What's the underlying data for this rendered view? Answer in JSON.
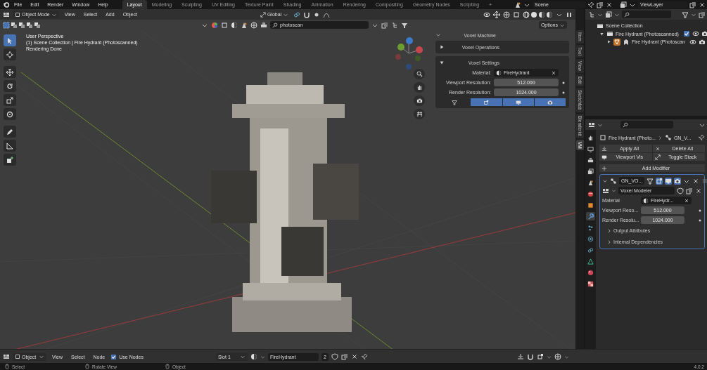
{
  "top_bar": {
    "menus": [
      "File",
      "Edit",
      "Render",
      "Window",
      "Help"
    ],
    "workspaces": [
      {
        "label": "Layout",
        "selected": true
      },
      {
        "label": "Modeling",
        "selected": false
      },
      {
        "label": "Sculpting",
        "selected": false
      },
      {
        "label": "UV Editing",
        "selected": false
      },
      {
        "label": "Texture Paint",
        "selected": false
      },
      {
        "label": "Shading",
        "selected": false
      },
      {
        "label": "Animation",
        "selected": false
      },
      {
        "label": "Rendering",
        "selected": false
      },
      {
        "label": "Compositing",
        "selected": false
      },
      {
        "label": "Geometry Nodes",
        "selected": false
      },
      {
        "label": "Scripting",
        "selected": false
      }
    ],
    "add_workspace": "+",
    "scene": "Scene",
    "view_layer": "ViewLayer"
  },
  "viewport": {
    "mode": "Object Mode",
    "menus": [
      "View",
      "Select",
      "Add",
      "Object"
    ],
    "orientation": "Global",
    "search": "photoscan",
    "options": "Options",
    "overlay_lines": [
      "User Perspective",
      "(1) Scene Collection | Fire Hydrant (Photoscanned)",
      "Rendering Done"
    ],
    "tools": [
      {
        "kind": "select",
        "selected": true
      },
      {
        "kind": "cursor",
        "selected": false
      },
      {
        "kind": "move",
        "selected": false
      },
      {
        "kind": "rotate",
        "selected": false
      },
      {
        "kind": "scale",
        "selected": false
      },
      {
        "kind": "transform",
        "selected": false
      },
      {
        "kind": "annotate",
        "selected": false
      },
      {
        "kind": "measure",
        "selected": false
      },
      {
        "kind": "add_cube",
        "selected": false
      }
    ]
  },
  "sidebar_tabs": [
    {
      "label": "Item",
      "selected": false
    },
    {
      "label": "Tool",
      "selected": false
    },
    {
      "label": "View",
      "selected": false
    },
    {
      "label": "Edit",
      "selected": false
    },
    {
      "label": "Sketchfab",
      "selected": false
    },
    {
      "label": "Blenderkit",
      "selected": false
    },
    {
      "label": "VM",
      "selected": true
    }
  ],
  "voxel_panel": {
    "title": "Voxel Machine",
    "sections": [
      {
        "title": "Voxel Operations",
        "expanded": false
      },
      {
        "title": "Voxel Settings",
        "expanded": true
      }
    ],
    "material_label": "Material:",
    "material": "FireHydrant",
    "fields": [
      {
        "label": "Viewport Resolution:",
        "value": "512.000"
      },
      {
        "label": "Render Resolution:",
        "value": "1024.000"
      }
    ],
    "toggles": [
      {
        "kind": "funnel",
        "on": false
      },
      {
        "kind": "edit",
        "on": true
      },
      {
        "kind": "monitor",
        "on": true
      },
      {
        "kind": "camera",
        "on": true
      }
    ]
  },
  "outliner": {
    "title": "Scene Collection",
    "children": [
      {
        "label": "Fire Hydrant (Photoscanned)",
        "expanded": true,
        "checked": true,
        "children": [
          {
            "label": "Fire Hydrant (Photoscan",
            "expanded": false
          }
        ]
      }
    ]
  },
  "properties": {
    "tabs": [
      {
        "kind": "tool",
        "selected": false
      },
      {
        "kind": "render",
        "selected": false
      },
      {
        "kind": "output",
        "selected": false
      },
      {
        "kind": "view_layer",
        "selected": false
      },
      {
        "kind": "scene",
        "selected": false
      },
      {
        "kind": "world",
        "selected": false
      },
      {
        "kind": "object",
        "selected": false
      },
      {
        "kind": "modifier",
        "selected": true
      },
      {
        "kind": "particles",
        "selected": false
      },
      {
        "kind": "physics",
        "selected": false
      },
      {
        "kind": "constraints",
        "selected": false
      },
      {
        "kind": "data",
        "selected": false
      },
      {
        "kind": "material",
        "selected": false
      },
      {
        "kind": "texture",
        "selected": false
      }
    ],
    "object": "Fire Hydrant (Photo...",
    "modifier_crumb": "GN_V...",
    "buttons": [
      "Apply All",
      "Delete All",
      "Viewport Vis",
      "Toggle Stack"
    ],
    "add_modifier": "Add Modifier",
    "modifier": {
      "name": "GN_VO...",
      "node_group": "Voxel Modeler",
      "material_label": "Material",
      "material": "FireHydr...",
      "fields": [
        {
          "label": "Viewport Reso...",
          "value": "512.000"
        },
        {
          "label": "Render Resolu...",
          "value": "1024.000"
        }
      ],
      "subpanels": [
        {
          "title": "Output Attributes",
          "expanded": false
        },
        {
          "title": "Internal Dependencies",
          "expanded": false
        }
      ]
    }
  },
  "node_header": {
    "mode": "Object",
    "menus": [
      "View",
      "Select",
      "Node"
    ],
    "use_nodes": {
      "label": "Use Nodes",
      "checked": true
    },
    "slot": "Slot 1",
    "material": "FireHydrant",
    "users": "2"
  },
  "status_bar": {
    "hints": [
      "Select",
      "Rotate View",
      "Object"
    ],
    "version": "4.0.2"
  }
}
